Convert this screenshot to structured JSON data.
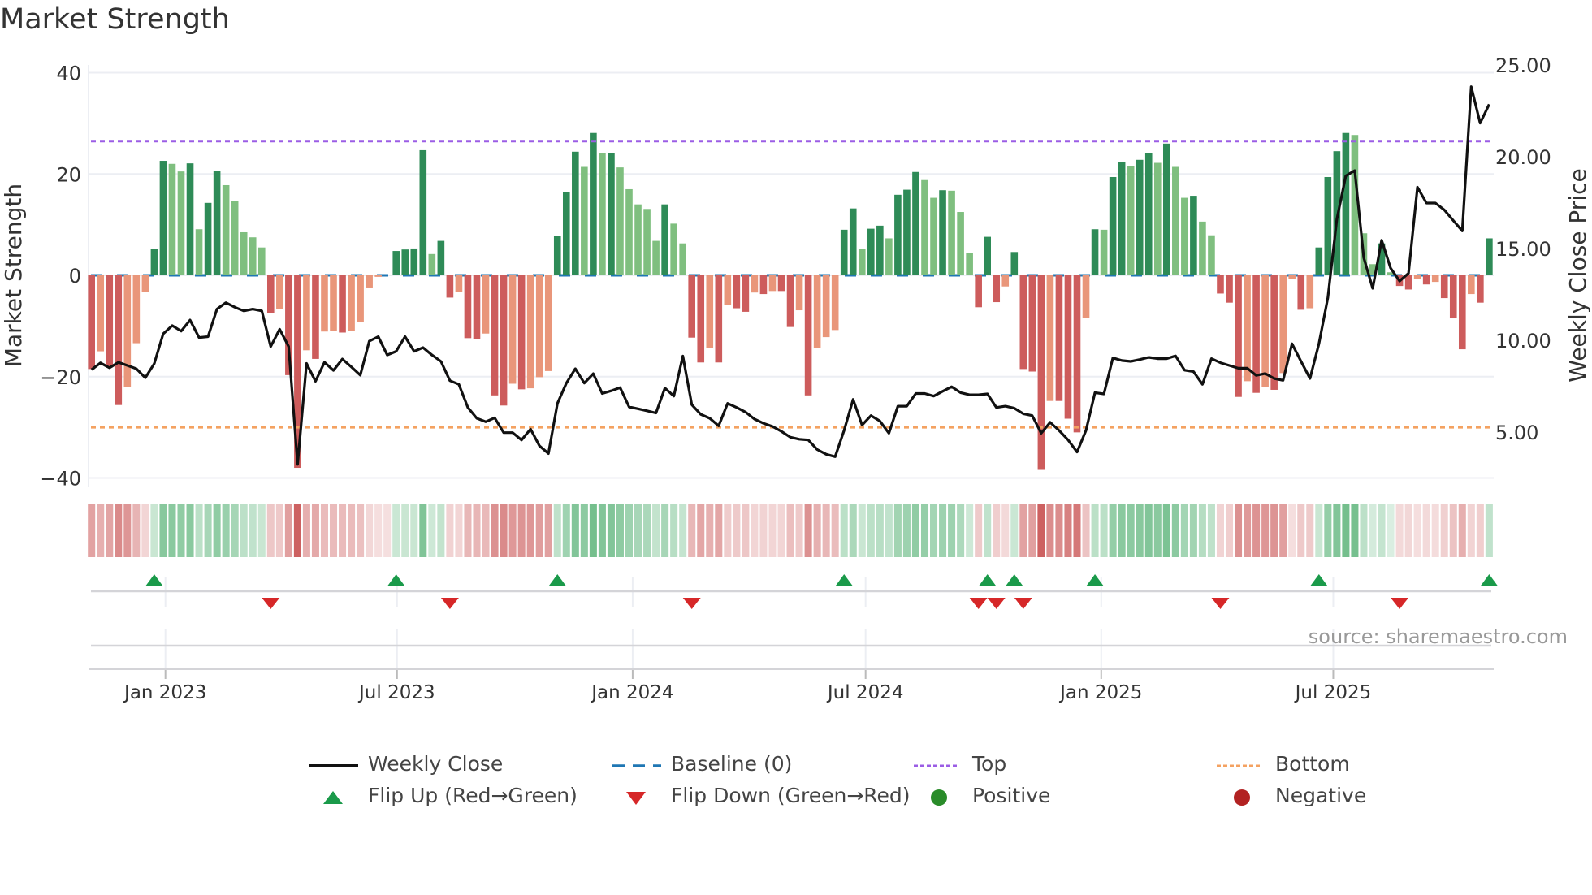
{
  "title": "Market Strength",
  "source": "source: sharemaestro.com",
  "legend": [
    {
      "label": "Weekly Close",
      "kind": "line-solid",
      "color": "#111111"
    },
    {
      "label": "Baseline (0)",
      "kind": "line-dashed",
      "color": "#1f77b4"
    },
    {
      "label": "Top",
      "kind": "line-dotted",
      "color": "#9b5de5"
    },
    {
      "label": "Bottom",
      "kind": "line-dotted",
      "color": "#f4a261"
    },
    {
      "label": "Flip Up (Red→Green)",
      "kind": "triangle-up",
      "color": "#1a9a4a"
    },
    {
      "label": "Flip Down (Green→Red)",
      "kind": "triangle-down",
      "color": "#d62728"
    },
    {
      "label": "Positive",
      "kind": "circle",
      "color": "#2a8c2a"
    },
    {
      "label": "Negative",
      "kind": "circle",
      "color": "#b22222"
    }
  ],
  "chart_data": {
    "type": "bar",
    "title": "Market Strength",
    "ylabel": "Market Strength",
    "ylabel_right": "Weekly Close Price",
    "ylim": [
      -40,
      40
    ],
    "yticks": [
      40,
      20,
      0,
      -20,
      -40
    ],
    "ylim_right": [
      5,
      25
    ],
    "yticks_right": [
      25,
      20,
      15,
      10,
      5
    ],
    "top_level": 26.5,
    "bottom_level": -30,
    "baseline": 0,
    "x_ticks": [
      {
        "label": "Jan 2023",
        "week": 8.25
      },
      {
        "label": "Jul 2023",
        "week": 34.1
      },
      {
        "label": "Jan 2024",
        "week": 60.4
      },
      {
        "label": "Jul 2024",
        "week": 86.4
      },
      {
        "label": "Jan 2025",
        "week": 112.7
      },
      {
        "label": "Jul 2025",
        "week": 138.6
      }
    ],
    "colors": {
      "pos_strong": "#2e8b57",
      "pos_weak": "#7fbf7f",
      "neg_strong": "#cd5c5c",
      "neg_weak": "#e9967a",
      "close": "#111111",
      "baseline": "#1f77b4",
      "top": "#9b5de5",
      "bottom": "#f4a261",
      "flip_up": "#1a9a4a",
      "flip_down": "#d62728"
    },
    "strength": [
      -18.5,
      -15,
      -18.2,
      -25.6,
      -22,
      -13.4,
      -3.3,
      5.2,
      22.6,
      22,
      20.5,
      22.1,
      9.1,
      14.3,
      20.6,
      17.8,
      14.7,
      8.5,
      7.5,
      5.5,
      -7.4,
      -6.7,
      -19.7,
      -38,
      -14.8,
      -16.5,
      -11.1,
      -11,
      -11.3,
      -11,
      -9.3,
      -2.4,
      -0.3,
      0,
      4.8,
      5.1,
      5.3,
      24.7,
      4.2,
      6.8,
      -4.4,
      -3.3,
      -12.4,
      -12.6,
      -11.5,
      -23.7,
      -25.7,
      -21.4,
      -22.5,
      -22.3,
      -20.1,
      -18.9,
      7.7,
      16.5,
      24.4,
      21.4,
      28.1,
      24.1,
      24.1,
      21.3,
      17,
      14,
      13.1,
      6.8,
      14,
      10.2,
      6.3,
      -12.3,
      -17.2,
      -14.4,
      -17.2,
      -5.8,
      -6.5,
      -7.2,
      -3.4,
      -3.7,
      -3.1,
      -3.1,
      -10.2,
      -6.9,
      -23.7,
      -14.4,
      -12.2,
      -10.8,
      9,
      13.2,
      5.2,
      9.2,
      9.8,
      7.3,
      15.9,
      16.9,
      20.4,
      18.8,
      15.3,
      16.8,
      16.7,
      12.5,
      4.4,
      -6.3,
      7.6,
      -5.3,
      -2.2,
      4.6,
      -18.5,
      -19,
      -38.4,
      -24.8,
      -24.8,
      -28.3,
      -31,
      -8.4,
      9.1,
      9,
      19.4,
      22.3,
      21.6,
      22.8,
      24.1,
      22.2,
      26,
      21.4,
      15.3,
      15.7,
      10.6,
      7.9,
      -3.6,
      -5.4,
      -24,
      -20.9,
      -23.2,
      -22,
      -22.6,
      -19.3,
      -0.7,
      -6.8,
      -6.5,
      5.5,
      19.4,
      24.5,
      28.1,
      27.7,
      8.3,
      2.2,
      6.3,
      0.6,
      -2.1,
      -2.8,
      -0.7,
      -1.8,
      -1.3,
      -4.5,
      -8.5,
      -14.6,
      -3.7,
      -5.4,
      7.3
    ],
    "close": [
      8.4,
      8.77,
      8.5,
      8.8,
      8.63,
      8.45,
      7.96,
      8.73,
      10.35,
      10.8,
      10.5,
      11.1,
      10.15,
      10.2,
      11.7,
      12.05,
      11.8,
      11.6,
      11.7,
      11.6,
      9.66,
      10.6,
      9.66,
      3.24,
      8.74,
      7.77,
      8.8,
      8.36,
      8.98,
      8.55,
      8.1,
      9.95,
      10.2,
      9.2,
      9.4,
      10.2,
      9.4,
      9.6,
      9.2,
      8.85,
      7.8,
      7.6,
      6.34,
      5.75,
      5.56,
      5.78,
      4.97,
      4.97,
      4.57,
      5.16,
      4.25,
      3.83,
      6.56,
      7.67,
      8.45,
      7.67,
      8.18,
      7.1,
      7.25,
      7.42,
      6.37,
      6.27,
      6.16,
      6.04,
      7.4,
      6.96,
      9.14,
      6.49,
      5.97,
      5.75,
      5.34,
      6.56,
      6.34,
      6.09,
      5.71,
      5.48,
      5.31,
      5.04,
      4.72,
      4.61,
      4.57,
      4.05,
      3.79,
      3.66,
      5.09,
      6.78,
      5.38,
      5.9,
      5.6,
      4.94,
      6.41,
      6.41,
      7.1,
      7.1,
      6.96,
      7.22,
      7.47,
      7.15,
      7.03,
      7.03,
      7.08,
      6.34,
      6.41,
      6.3,
      6.0,
      5.9,
      4.94,
      5.53,
      5.09,
      4.57,
      3.91,
      5.09,
      7.15,
      7.08,
      9.04,
      8.9,
      8.85,
      8.95,
      9.07,
      9.0,
      9.0,
      9.15,
      8.37,
      8.29,
      7.6,
      9.0,
      8.78,
      8.63,
      8.48,
      8.48,
      8.09,
      8.19,
      7.92,
      7.82,
      9.81,
      8.85,
      7.92,
      9.81,
      12.32,
      16.6,
      18.96,
      19.25,
      14.5,
      12.83,
      15.45,
      13.94,
      13.23,
      13.65,
      18.34,
      17.48,
      17.48,
      17.1,
      16.52,
      15.96,
      23.82,
      21.83,
      22.86
    ],
    "flip_up_weeks": [
      8,
      35,
      53,
      85,
      101,
      104,
      113,
      138,
      157
    ],
    "flip_down_weeks": [
      21,
      41,
      68,
      100,
      102,
      105,
      127,
      147
    ]
  }
}
